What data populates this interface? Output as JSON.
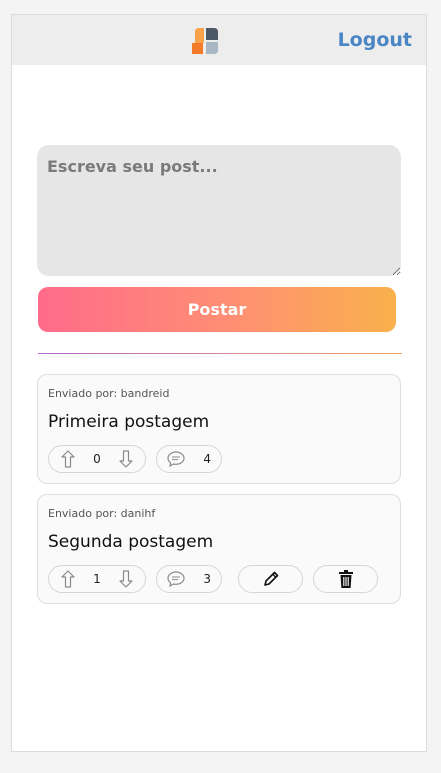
{
  "header": {
    "logout_label": "Logout"
  },
  "composer": {
    "placeholder": "Escreva seu post...",
    "submit_label": "Postar"
  },
  "posts": [
    {
      "author": "Enviado por: bandreid",
      "title": "Primeira postagem",
      "votes": "0",
      "comments": "4",
      "owned": false
    },
    {
      "author": "Enviado por: danihf",
      "title": "Segunda postagem",
      "votes": "1",
      "comments": "3",
      "owned": true
    }
  ],
  "colors": {
    "accent": "#4a85c4",
    "gradient_start": "#ff6b8a",
    "gradient_end": "#f9b14c"
  }
}
